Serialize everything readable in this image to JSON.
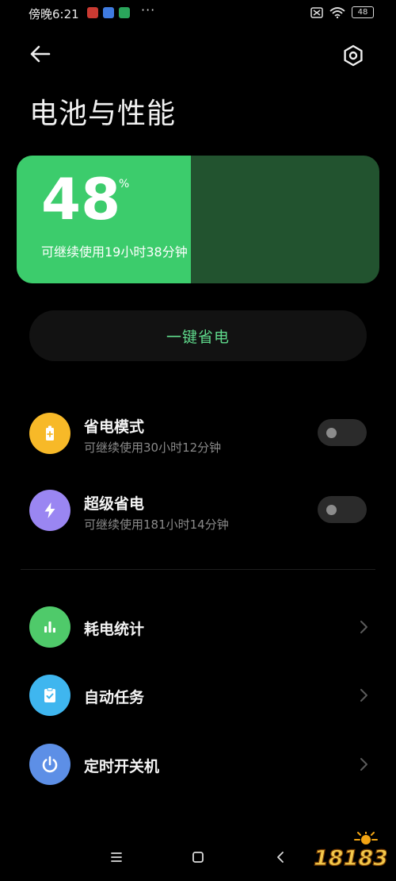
{
  "status_bar": {
    "time": "傍晚6:21",
    "app_icons": [
      "app-icon-red",
      "app-icon-blue",
      "app-icon-green"
    ],
    "more": "···",
    "battery_level": "48"
  },
  "header": {
    "title": "电池与性能"
  },
  "battery": {
    "level": "48",
    "unit": "%",
    "fill_percent": 48,
    "remaining": "可继续使用19小时38分钟"
  },
  "one_key_save": {
    "label": "一键省电"
  },
  "modes": [
    {
      "title": "省电模式",
      "subtitle": "可继续使用30小时12分钟",
      "icon": "battery-plus-icon",
      "icon_color": "#f7b928",
      "enabled": false
    },
    {
      "title": "超级省电",
      "subtitle": "可继续使用181小时14分钟",
      "icon": "lightning-icon",
      "icon_color": "#9a86f2",
      "enabled": false
    }
  ],
  "menu": [
    {
      "title": "耗电统计",
      "icon": "bar-chart-icon",
      "icon_color": "#4fca6a"
    },
    {
      "title": "自动任务",
      "icon": "clipboard-check-icon",
      "icon_color": "#3fb6ef"
    },
    {
      "title": "定时开关机",
      "icon": "power-icon",
      "icon_color": "#5d8fe6"
    }
  ],
  "watermark": {
    "text": "18183"
  },
  "colors": {
    "accent_green": "#3ccc6c",
    "card_dark_green": "#22532f",
    "button_text": "#5fd98b",
    "background": "#000000"
  }
}
